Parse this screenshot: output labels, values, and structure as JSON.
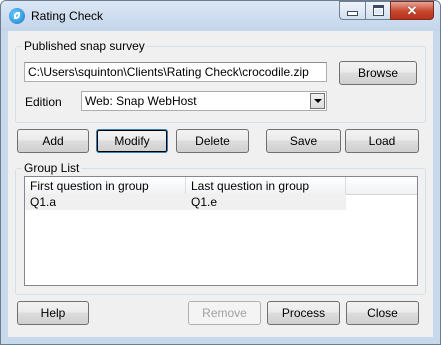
{
  "window": {
    "title": "Rating Check"
  },
  "snap_survey_group": {
    "legend": "Published snap survey",
    "file_path": "C:\\Users\\squinton\\Clients\\Rating Check\\crocodile.zip",
    "browse_label": "Browse",
    "edition_label": "Edition",
    "edition_value": "Web: Snap WebHost"
  },
  "toolbar": {
    "add": "Add",
    "modify": "Modify",
    "delete": "Delete",
    "save": "Save",
    "load": "Load"
  },
  "group_list": {
    "legend": "Group List",
    "columns": [
      "First question in group",
      "Last question in group",
      ""
    ],
    "rows": [
      {
        "first": "Q1.a",
        "last": "Q1.e"
      }
    ]
  },
  "footer": {
    "help": "Help",
    "remove": "Remove",
    "process": "Process",
    "close": "Close"
  }
}
